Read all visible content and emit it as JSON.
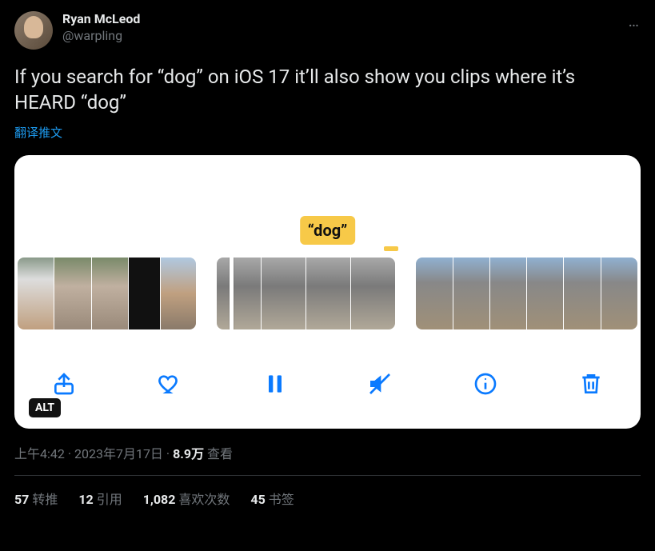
{
  "author": {
    "display_name": "Ryan McLeod",
    "handle": "@warpling"
  },
  "more_icon": "…",
  "body": "If you search for “dog” on iOS 17 it’ll also show you clips where it’s HEARD “dog”",
  "translate_label": "翻译推文",
  "media": {
    "tag_label": "“dog”",
    "alt_badge": "ALT",
    "toolbar": {
      "share": "share-icon",
      "like": "heart-icon",
      "pause": "pause-icon",
      "mute": "mute-icon",
      "info": "info-icon",
      "trash": "trash-icon"
    }
  },
  "meta": {
    "time": "上午4:42",
    "dot1": " · ",
    "date": "2023年7月17日",
    "dot2": " · ",
    "views_count": "8.9万",
    "views_label": " 查看"
  },
  "stats": {
    "retweets_n": "57",
    "retweets_label": "转推",
    "quotes_n": "12",
    "quotes_label": "引用",
    "likes_n": "1,082",
    "likes_label": "喜欢次数",
    "bookmarks_n": "45",
    "bookmarks_label": "书签"
  }
}
